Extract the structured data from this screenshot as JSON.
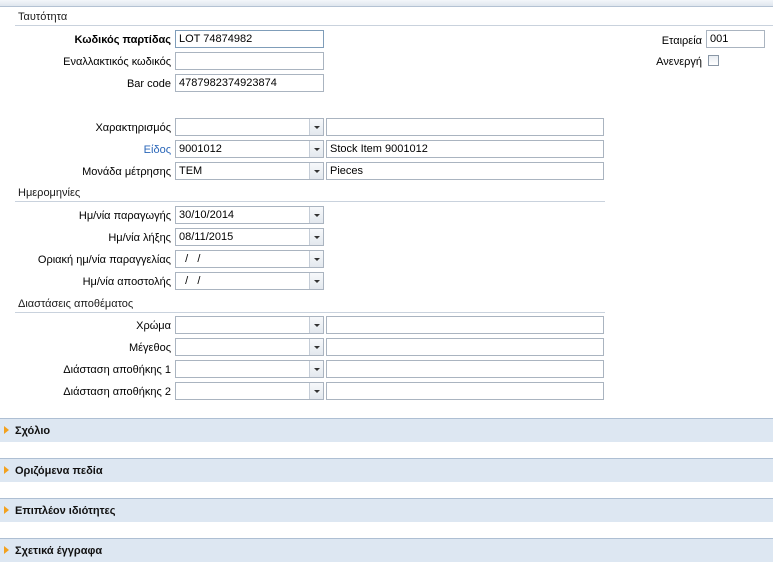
{
  "identity": {
    "title": "Ταυτότητα",
    "lot_code_label": "Κωδικός παρτίδας",
    "lot_code_value": "LOT 74874982",
    "alt_code_label": "Εναλλακτικός κωδικός",
    "alt_code_value": "",
    "barcode_label": "Bar code",
    "barcode_value": "4787982374923874",
    "company_label": "Εταιρεία",
    "company_value": "001",
    "inactive_label": "Ανενεργή",
    "characterization_label": "Χαρακτηρισμός",
    "characterization_value": "",
    "characterization_desc": "",
    "item_label": "Είδος",
    "item_value": "9001012",
    "item_desc": "Stock Item 9001012",
    "unit_label": "Μονάδα μέτρησης",
    "unit_value": "TEM",
    "unit_desc": "Pieces"
  },
  "dates": {
    "title": "Ημερομηνίες",
    "production_label": "Ημ/νία παραγωγής",
    "production_value": "30/10/2014",
    "expiry_label": "Ημ/νία λήξης",
    "expiry_value": "08/11/2015",
    "order_limit_label": "Οριακή ημ/νία παραγγελίας",
    "order_limit_value": "  /   /",
    "dispatch_label": "Ημ/νία αποστολής",
    "dispatch_value": "  /   /"
  },
  "dimensions": {
    "title": "Διαστάσεις αποθέματος",
    "color_label": "Χρώμα",
    "size_label": "Μέγεθος",
    "dim1_label": "Διάσταση αποθήκης 1",
    "dim2_label": "Διάσταση αποθήκης 2"
  },
  "panels": {
    "comment": "Σχόλιο",
    "user_fields": "Οριζόμενα πεδία",
    "extra_props": "Επιπλέον ιδιότητες",
    "related_docs": "Σχετικά έγγραφα"
  }
}
